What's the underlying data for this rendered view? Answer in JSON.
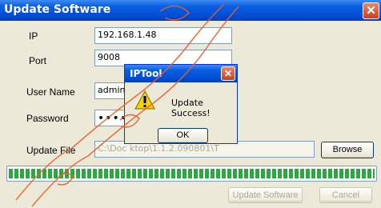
{
  "window": {
    "title": "Update Software",
    "close_glyph": "✕"
  },
  "form": {
    "ip_label": "IP",
    "ip_value": "192.168.1.48",
    "port_label": "Port",
    "port_value": "9008",
    "username_label": "User Name",
    "username_value": "admin",
    "password_label": "Password",
    "password_value": "•••••",
    "updatefile_label": "Update File",
    "updatefile_value": "C:\\Doc                                              ktop\\1.1.2.090801\\T",
    "browse_label": "Browse"
  },
  "progress": {
    "fraction": 1.0,
    "color": "#2ba840"
  },
  "actions": {
    "update_label": "Update Software",
    "cancel_label": "Cancel"
  },
  "dialog": {
    "title": "IPTool",
    "close_glyph": "✕",
    "message": "Update Success!",
    "ok_label": "OK",
    "icon": "warning-icon"
  },
  "colors": {
    "titlebar": "#0054e3",
    "close_button": "#d4502f",
    "watermark": "#e8602a"
  }
}
